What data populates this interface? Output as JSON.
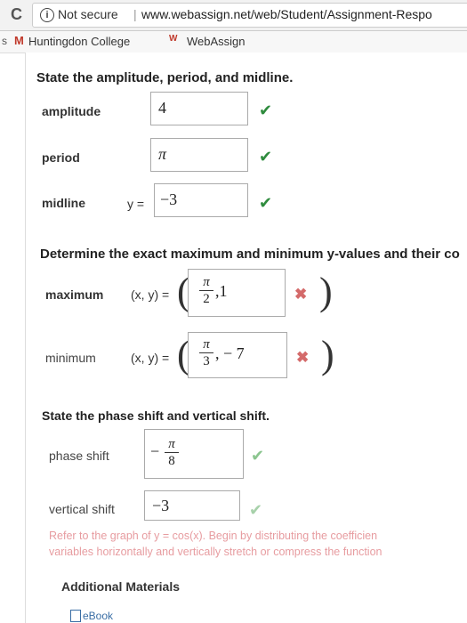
{
  "browser": {
    "not_secure": "Not secure",
    "separator": "|",
    "url": "www.webassign.net/web/Student/Assignment-Respo",
    "bookmark_frag": "s",
    "bookmark_1_icon": "M",
    "bookmark_1": "Huntingdon College",
    "bookmark_2_icon": "W",
    "bookmark_2": "WebAssign"
  },
  "part1": {
    "question": "State the amplitude, period, and midline.",
    "amplitude_label": "amplitude",
    "amplitude_value": "4",
    "period_label": "period",
    "period_value": "π",
    "midline_label": "midline",
    "midline_prefix": "y =",
    "midline_value": "−3"
  },
  "part2": {
    "question": "Determine the exact maximum and minimum y-values and their co",
    "maximum_label": "maximum",
    "maximum_prefix": "(x, y) =",
    "maximum_x_num": "π",
    "maximum_x_den": "2",
    "maximum_y": ",1",
    "minimum_label": "minimum",
    "minimum_prefix": "(x, y) =",
    "minimum_x_num": "π",
    "minimum_x_den": "3",
    "minimum_y": ", − 7"
  },
  "part3": {
    "question": "State the phase shift and vertical shift.",
    "phase_label": "phase shift",
    "phase_sign": "−",
    "phase_num": "π",
    "phase_den": "8",
    "vertical_label": "vertical shift",
    "vertical_value": "−3"
  },
  "hint": {
    "line1": "Refer to the graph of y = cos(x). Begin by distributing the coefficien",
    "line2": "variables horizontally and vertically stretch or compress the function"
  },
  "additional": {
    "title": "Additional Materials",
    "ebook": "eBook"
  },
  "icons": {
    "check": "✔",
    "cross": "✖"
  }
}
